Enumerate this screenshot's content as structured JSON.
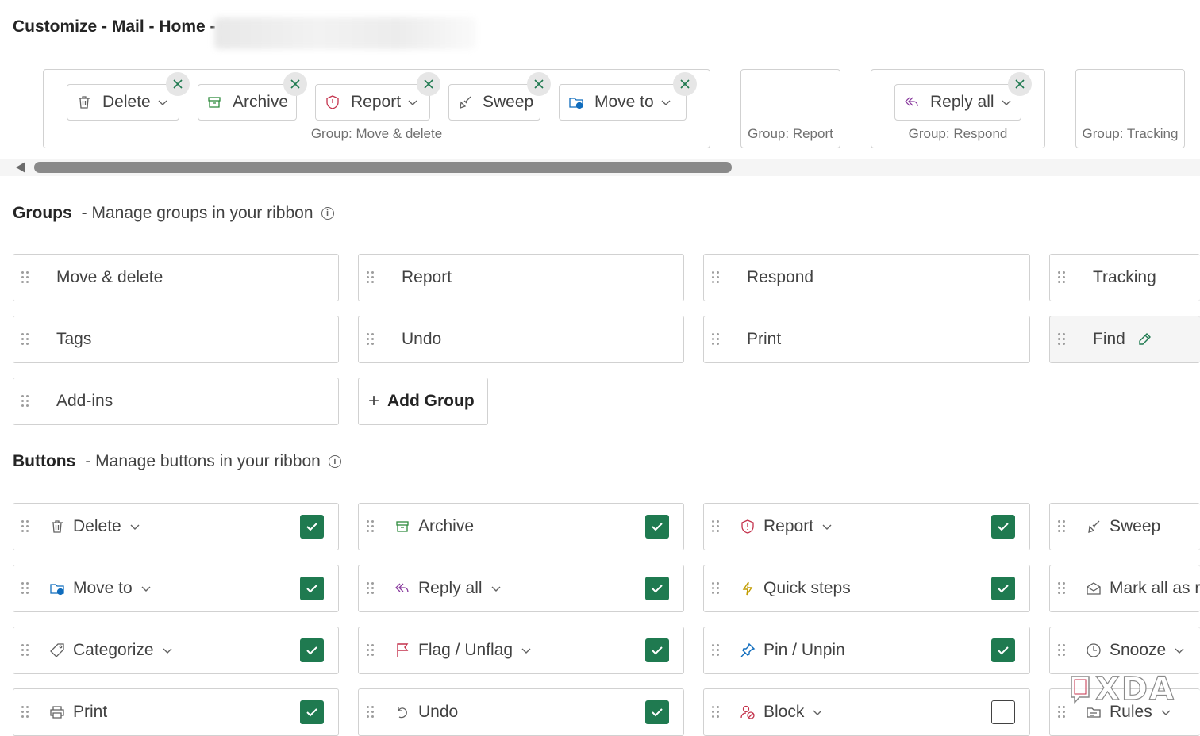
{
  "header": {
    "title": "Customize - Mail - Home -"
  },
  "ribbon_preview": {
    "groups": [
      {
        "caption": "Group: Move & delete",
        "buttons": [
          {
            "label": "Delete",
            "icon": "trash-icon"
          },
          {
            "label": "Archive",
            "icon": "archive-icon"
          },
          {
            "label": "Report",
            "icon": "shield-icon"
          },
          {
            "label": "Sweep",
            "icon": "broom-icon"
          },
          {
            "label": "Move to",
            "icon": "folder-move-icon"
          }
        ]
      },
      {
        "caption": "Group: Report",
        "buttons": []
      },
      {
        "caption": "Group: Respond",
        "buttons": [
          {
            "label": "Reply all",
            "icon": "reply-all-icon"
          }
        ]
      },
      {
        "caption": "Group: Tracking",
        "buttons": []
      }
    ]
  },
  "groups_section": {
    "heading": "Groups",
    "description": "- Manage groups in your ribbon",
    "items": [
      "Move & delete",
      "Report",
      "Respond",
      "Tracking",
      "Tags",
      "Undo",
      "Print",
      "Find",
      "Add-ins"
    ],
    "add_label": "Add Group",
    "add_icon": "plus-icon"
  },
  "buttons_section": {
    "heading": "Buttons",
    "description": "- Manage buttons in your ribbon",
    "items": [
      {
        "label": "Delete",
        "icon": "trash-icon",
        "checked": true
      },
      {
        "label": "Archive",
        "icon": "archive-icon",
        "checked": true
      },
      {
        "label": "Report",
        "icon": "shield-icon",
        "checked": true
      },
      {
        "label": "Sweep",
        "icon": "broom-icon"
      },
      {
        "label": "Move to",
        "icon": "folder-move-icon",
        "checked": true
      },
      {
        "label": "Reply all",
        "icon": "reply-all-icon",
        "checked": true
      },
      {
        "label": "Quick steps",
        "icon": "lightning-icon",
        "checked": true
      },
      {
        "label": "Mark all as re",
        "icon": "envelope-open-icon"
      },
      {
        "label": "Categorize",
        "icon": "tag-icon",
        "checked": true
      },
      {
        "label": "Flag / Unflag",
        "icon": "flag-icon",
        "checked": true
      },
      {
        "label": "Pin / Unpin",
        "icon": "pin-icon",
        "checked": true
      },
      {
        "label": "Snooze",
        "icon": "clock-icon"
      },
      {
        "label": "Print",
        "icon": "printer-icon",
        "checked": true
      },
      {
        "label": "Undo",
        "icon": "undo-icon",
        "checked": true
      },
      {
        "label": "Block",
        "icon": "block-user-icon",
        "checked": false
      },
      {
        "label": "Rules",
        "icon": "rules-icon"
      }
    ]
  },
  "colors": {
    "accent_green": "#1f7a50",
    "border": "#d1d1d1"
  },
  "watermark": {
    "text": "XDA",
    "icon": "xda-logo-icon"
  }
}
